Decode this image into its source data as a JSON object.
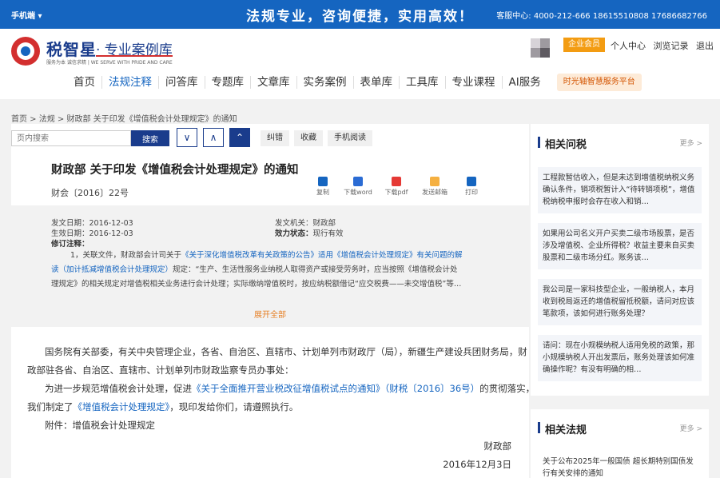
{
  "topbar": {
    "mobile": "手机端 ▾",
    "slogan": "法规专业，咨询便捷，实用高效！",
    "hotline": "客服中心: 4000-212-666 18615510808 17686682766"
  },
  "header": {
    "logo_name": "税智星",
    "logo_sub": "· 专业案例库",
    "logo_tag": "服务为本 诚信求精 | WE SERVE WITH PRIDE AND CARE",
    "vip": "企业会员",
    "links": [
      "个人中心",
      "浏览记录",
      "退出"
    ]
  },
  "nav": {
    "items": [
      "首页",
      "法规注释",
      "问答库",
      "专题库",
      "文章库",
      "实务案例",
      "表单库",
      "工具库",
      "专业课程",
      "AI服务"
    ],
    "platform": "时光轴智慧服务平台"
  },
  "breadcrumb": "首页 > 法规 > 财政部 关于印发《增值税会计处理规定》的通知",
  "toolbar": {
    "search_placeholder": "页内搜索",
    "search_label": "搜索",
    "down_arrow": "∨",
    "up_arrow": "∧",
    "top_arrow": "⌃",
    "correct": "纠错",
    "favorite": "收藏",
    "mobile_read": "手机阅读"
  },
  "doc": {
    "title": "财政部 关于印发《增值税会计处理规定》的通知",
    "number": "财会〔2016〕22号",
    "actions": [
      "复制",
      "下载word",
      "下载pdf",
      "发送邮箱",
      "打印"
    ]
  },
  "meta": {
    "issue_date_label": "发文日期：",
    "issue_date": "2016-12-03",
    "effective_date_label": "生效日期：",
    "effective_date": "2016-12-03",
    "authority_label": "发文机关：",
    "authority": "财政部",
    "status_label": "效力状态：",
    "status": "现行有效",
    "revision_label": "修订注释：",
    "note_line1_a": "1，关联文件，财政部会计司关于",
    "note_line1_link": "《关于深化增值税改革有关政策的公告》适用《增值税会计处理规定》有关问题的解",
    "note_line2_link": "读（加计抵减增值税会计处理规定）",
    "note_line2_b": "规定：“生产、生活性服务业纳税人取得资产或接受劳务时，应当按照《增值税会计处",
    "note_line3": "理规定》的相关规定对增值税相关业务进行会计处理；实际缴纳增值税时，按应纳税额借记“应交税费——未交增值税”等…",
    "expand": "展开全部"
  },
  "body": {
    "p1_line1": "国务院有关部委，有关中央管理企业，各省、自治区、直辖市、计划单列市财政厅（局），新疆生产建设兵团财务局，财",
    "p1_line2": "政部驻各省、自治区、直辖市、计划单列市财政监察专员办事处：",
    "p2_a": "为进一步规范增值税会计处理，促进",
    "p2_link": "《关于全面推开营业税改征增值税试点的通知》（财税〔2016〕36号）",
    "p2_b": "的贯彻落实，",
    "p2_line2_a": "我们制定了",
    "p2_line2_link": "《增值税会计处理规定》",
    "p2_line2_b": "，现印发给你们，请遵照执行。",
    "attachment": "附件：增值税会计处理规定",
    "signer": "财政部",
    "sign_date": "2016年12月3日"
  },
  "sidebar": {
    "qa_title": "相关问税",
    "qa_more": "更多 >",
    "qa_items": [
      "工程款暂估收入，但是未达到增值税纳税义务确认条件，销项税暂计入“待转销项税”，增值税纳税申报时会存在收入和销…",
      "如果用公司名义开户买卖二级市场股票，是否涉及增值税、企业所得税？收益主要来自买卖股票和二级市场分红。账务该…",
      "我公司是一家科技型企业，一般纳税人，本月收到税局返还的增值税留抵税额，请问对应该笔款项，该如何进行账务处理？",
      "请问：现在小规模纳税人适用免税的政策，那小规模纳税人开出发票后，账务处理该如何准确操作呢？有没有明确的相…"
    ],
    "law_title": "相关法规",
    "law_more": "更多 >",
    "law_items": [
      "关于公布2025年一般国债 超长期特别国债发行有关安排的通知"
    ]
  }
}
